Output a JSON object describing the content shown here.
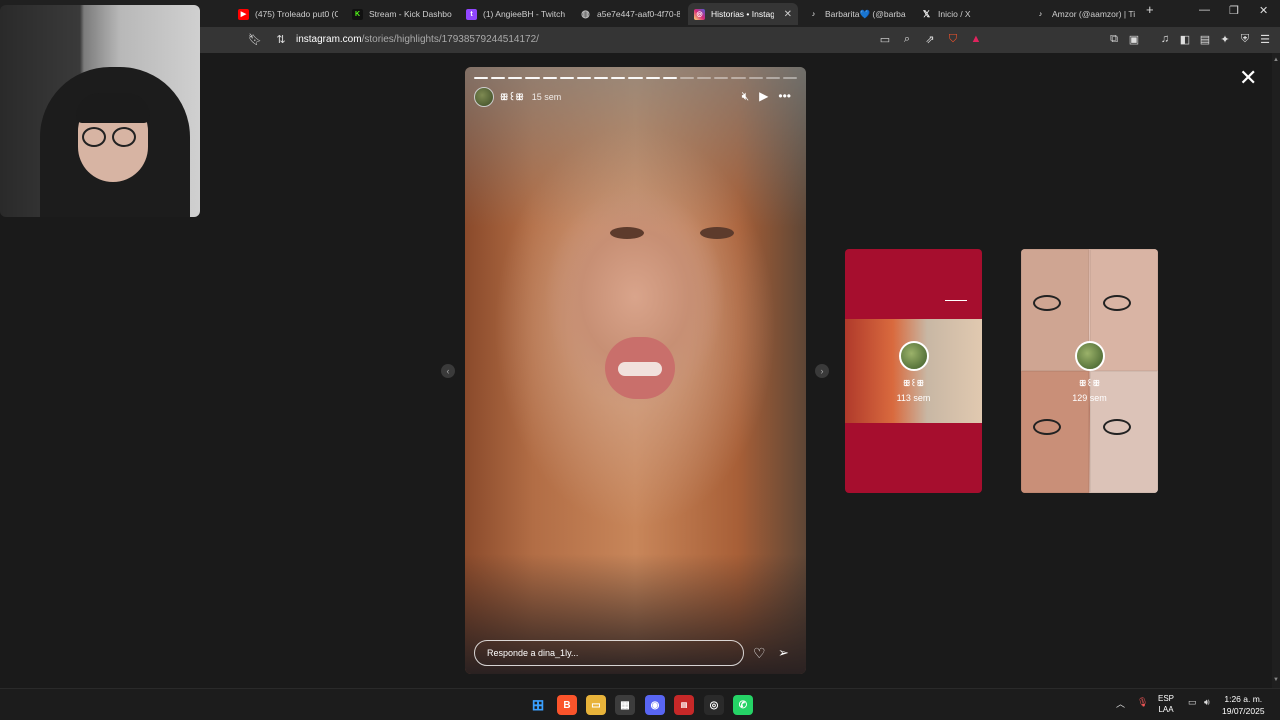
{
  "browser": {
    "tabs": [
      {
        "title": "(475) Troleado put0 (C",
        "icon": "youtube-icon",
        "color": "#ff0000"
      },
      {
        "title": "Stream - Kick Dashboa",
        "icon": "kick-icon",
        "color": "#53fc18"
      },
      {
        "title": "(1) AngieeBH - Twitch",
        "icon": "twitch-icon",
        "color": "#9146ff"
      },
      {
        "title": "a5e7e447-aaf0-4f70-8",
        "icon": "globe-icon",
        "color": "#888888"
      },
      {
        "title": "Historias • Instagr",
        "icon": "instagram-icon",
        "color": "#e1306c",
        "active": true
      },
      {
        "title": "Barbarita💙 (@barba",
        "icon": "tiktok-icon",
        "color": "#000000"
      },
      {
        "title": "Inicio / X",
        "icon": "x-icon",
        "color": "#000000"
      },
      {
        "title": "Amzor (@aamzor) | Ti",
        "icon": "tiktok-icon",
        "color": "#000000"
      }
    ],
    "url_host": "instagram.com",
    "url_path": "/stories/highlights/17938579244514172/"
  },
  "story": {
    "username": "ꕥ꒰ꕥ",
    "time": "15 sem",
    "reply_placeholder": "Responde a dina_1ly...",
    "progress_total": 19,
    "progress_done": 12
  },
  "previews": [
    {
      "name": "ꕥ꒰ꕥ",
      "time": "113 sem",
      "accent": "#a60e2e"
    },
    {
      "name": "ꕥ꒰ꕥ",
      "time": "129 sem"
    }
  ],
  "taskbar": {
    "lang_line1": "ESP",
    "lang_line2": "LAA",
    "time": "1:26 a. m.",
    "date": "19/07/2025"
  }
}
